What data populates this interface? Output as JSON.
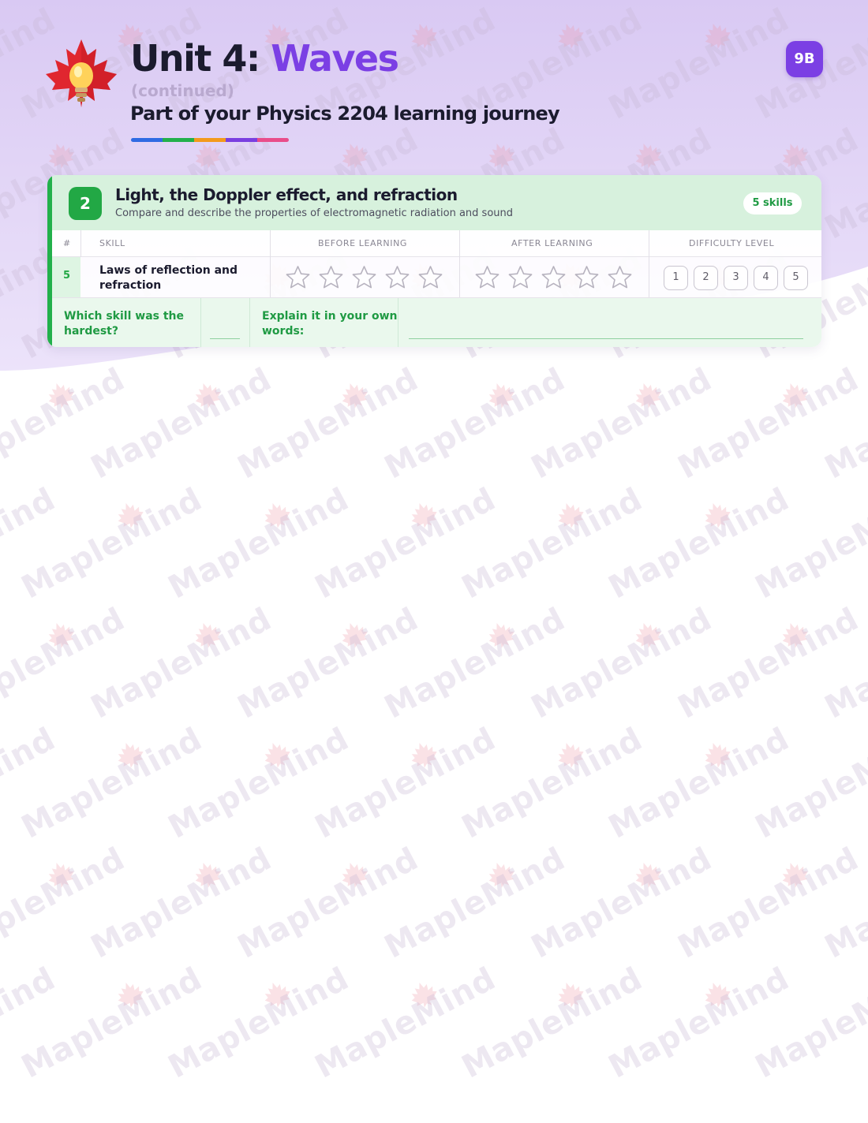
{
  "header": {
    "unit_prefix": "Unit 4:",
    "unit_name": "Waves",
    "continued": "(continued)",
    "journey": "Part of your Physics 2204 learning journey",
    "badge": "9B"
  },
  "section": {
    "number": "2",
    "title": "Light, the Doppler effect, and refraction",
    "subtitle": "Compare and describe the properties of electromagnetic radiation and sound",
    "skills_count": "5 skills"
  },
  "table": {
    "headers": [
      "#",
      "Skill",
      "Before learning",
      "After learning",
      "Difficulty level"
    ],
    "rows": [
      {
        "number": "5",
        "skill": "Laws of reflection and refraction",
        "before_rating": 0,
        "after_rating": 0,
        "difficulty_options": [
          "1",
          "2",
          "3",
          "4",
          "5"
        ]
      }
    ],
    "star_count": 5
  },
  "reflection": {
    "hardest_label": "Which skill was the hardest?",
    "explain_label": "Explain it in your own words:"
  },
  "watermark": {
    "text": "MapleMind"
  },
  "colors": {
    "purple": "#7b3fe4",
    "green": "#22a845",
    "lavender": "#e2d7f6"
  }
}
